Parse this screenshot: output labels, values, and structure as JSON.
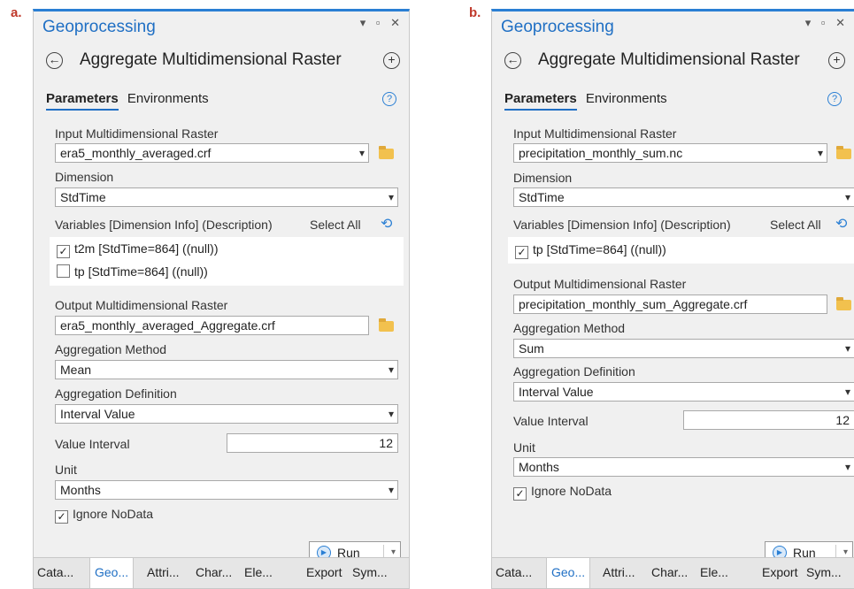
{
  "panels": [
    {
      "letter": "a.",
      "title": "Geoprocessing",
      "window_controls": "▾ ▫ ✕",
      "tool_title": "Aggregate Multidimensional Raster",
      "tabs": {
        "parameters": "Parameters",
        "environments": "Environments"
      },
      "input_label": "Input Multidimensional Raster",
      "input_value": "era5_monthly_averaged.crf",
      "dimension_label": "Dimension",
      "dimension_value": "StdTime",
      "variables_label": "Variables [Dimension Info] (Description)",
      "select_all": "Select All",
      "variables": [
        {
          "checked": true,
          "label": "t2m [StdTime=864] ((null))"
        },
        {
          "checked": false,
          "label": "tp [StdTime=864] ((null))"
        }
      ],
      "output_label": "Output Multidimensional Raster",
      "output_value": "era5_monthly_averaged_Aggregate.crf",
      "agg_method_label": "Aggregation Method",
      "agg_method_value": "Mean",
      "agg_def_label": "Aggregation Definition",
      "agg_def_value": "Interval Value",
      "value_interval_label": "Value Interval",
      "value_interval": "12",
      "unit_label": "Unit",
      "unit_value": "Months",
      "ignore_nodata": "Ignore NoData",
      "ignore_nodata_checked": true,
      "run_label": "Run",
      "bottom_tabs": [
        "Cata...",
        "Geo...",
        "Attri...",
        "Char...",
        "Ele...",
        "Export",
        "Sym..."
      ],
      "active_tab": 1
    },
    {
      "letter": "b.",
      "title": "Geoprocessing",
      "window_controls": "▾ ▫ ✕",
      "tool_title": "Aggregate Multidimensional Raster",
      "tabs": {
        "parameters": "Parameters",
        "environments": "Environments"
      },
      "input_label": "Input Multidimensional Raster",
      "input_value": "precipitation_monthly_sum.nc",
      "dimension_label": "Dimension",
      "dimension_value": "StdTime",
      "variables_label": "Variables [Dimension Info] (Description)",
      "select_all": "Select All",
      "variables": [
        {
          "checked": true,
          "label": "tp [StdTime=864] ((null))"
        }
      ],
      "output_label": "Output Multidimensional Raster",
      "output_value": "precipitation_monthly_sum_Aggregate.crf",
      "agg_method_label": "Aggregation Method",
      "agg_method_value": "Sum",
      "agg_def_label": "Aggregation Definition",
      "agg_def_value": "Interval Value",
      "value_interval_label": "Value Interval",
      "value_interval": "12",
      "unit_label": "Unit",
      "unit_value": "Months",
      "ignore_nodata": "Ignore NoData",
      "ignore_nodata_checked": true,
      "run_label": "Run",
      "bottom_tabs": [
        "Cata...",
        "Geo...",
        "Attri...",
        "Char...",
        "Ele...",
        "Export",
        "Sym..."
      ],
      "active_tab": 1
    }
  ],
  "colors": {
    "accent": "#2a7fd4",
    "title_blue": "#1f6fc4",
    "panel_bg": "#f0f0f0",
    "folder": "#f2c14e"
  }
}
